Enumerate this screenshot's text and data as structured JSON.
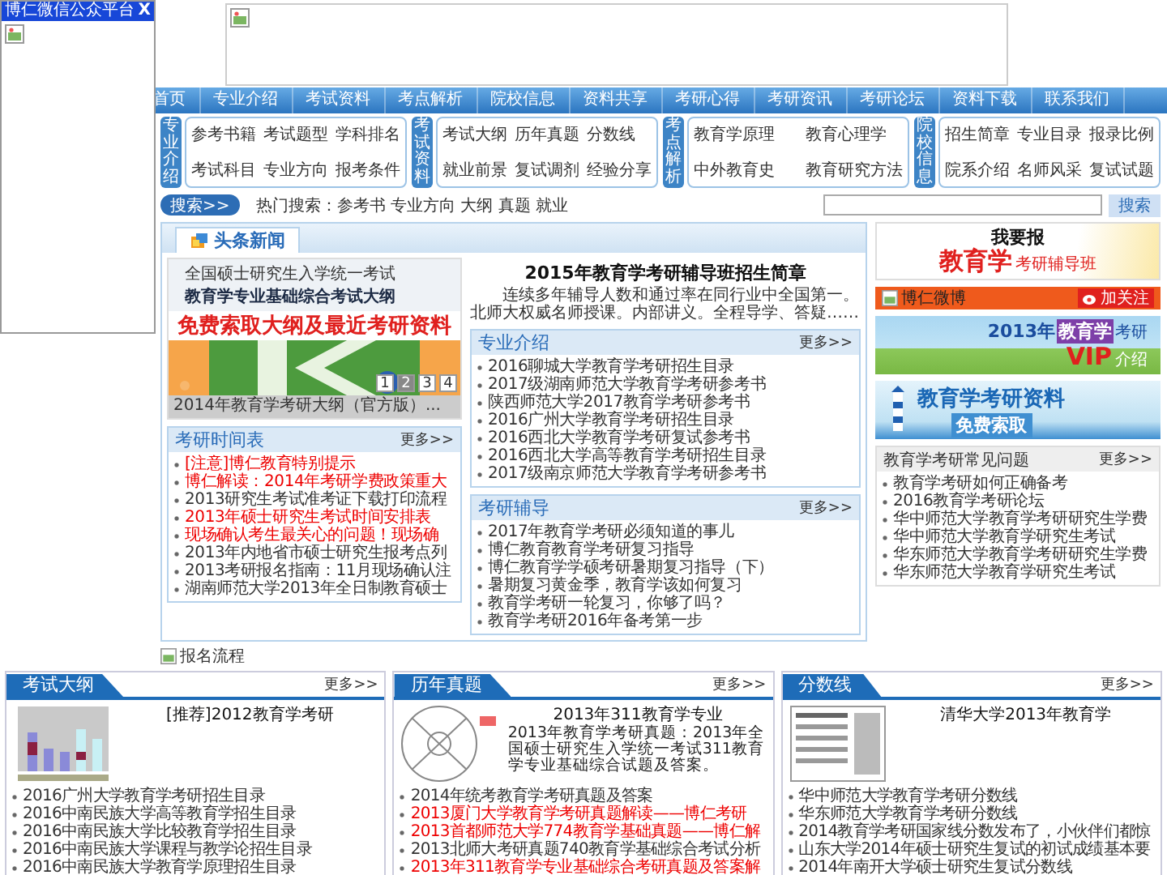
{
  "popup": {
    "title": "博仁微信公众平台",
    "close": "X"
  },
  "nav": [
    "首页",
    "专业介绍",
    "考试资料",
    "考点解析",
    "院校信息",
    "资料共享",
    "考研心得",
    "考研资讯",
    "考研论坛",
    "资料下载",
    "联系我们"
  ],
  "categories": [
    {
      "label": "专业介绍",
      "links": [
        "参考书籍",
        "考试题型",
        "学科排名",
        "考试科目",
        "专业方向",
        "报考条件"
      ]
    },
    {
      "label": "考试资料",
      "links": [
        "考试大纲",
        "历年真题",
        "分数线",
        "就业前景",
        "复试调剂",
        "经验分享"
      ]
    },
    {
      "label": "考点解析",
      "links": [
        "教育学原理",
        "教育心理学",
        "中外教育史",
        "教育研究方法"
      ]
    },
    {
      "label": "院校信息",
      "links": [
        "招生简章",
        "专业目录",
        "报录比例",
        "院系介绍",
        "名师风采",
        "复试试题"
      ]
    }
  ],
  "search": {
    "button": "搜索>>",
    "hot": "热门搜索：参考书 专业方向 大纲 真题 就业",
    "submit": "搜索"
  },
  "headline_panel": {
    "title": "头条新闻",
    "slideshow": {
      "cover_subtitle": "全国硕士研究生入学统一考试",
      "cover_title": "教育学专业基础综合考试大纲",
      "promo": "免费索取大纲及最近考研资料",
      "caption": "2014年教育学考研大纲（官方版）...",
      "pages": [
        {
          "label": "1",
          "selected": false
        },
        {
          "label": "2",
          "selected": true
        },
        {
          "label": "3",
          "selected": false
        },
        {
          "label": "4",
          "selected": false
        }
      ]
    },
    "headline": {
      "title": "2015年教育学考研辅导班招生简章",
      "summary": "连续多年辅导人数和通过率在同行业中全国第一。北师大权威名师授课。内部讲义。全程导学、答疑……"
    }
  },
  "schedule": {
    "title": "考研时间表",
    "more": "更多>>",
    "items": [
      {
        "text": "[注意]博仁教育特别提示",
        "highlighted": true
      },
      {
        "text": "博仁解读：2014年考研学费政策重大",
        "highlighted": true
      },
      {
        "text": "2013研究生考试准考证下载打印流程",
        "highlighted": false
      },
      {
        "text": "2013年硕士研究生考试时间安排表",
        "highlighted": true
      },
      {
        "text": "现场确认考生最关心的问题！现场确",
        "highlighted": true
      },
      {
        "text": "2013年内地省市硕士研究生报考点列",
        "highlighted": false
      },
      {
        "text": "2013考研报名指南：11月现场确认注",
        "highlighted": false
      },
      {
        "text": "湖南师范大学2013年全日制教育硕士",
        "highlighted": false
      }
    ]
  },
  "major_intro": {
    "title": "专业介绍",
    "more": "更多>>",
    "items": [
      "2016聊城大学教育学考研招生目录",
      "2017级湖南师范大学教育学考研参考书",
      "陕西师范大学2017教育学考研参考书",
      "2016广州大学教育学考研招生目录",
      "2016西北大学教育学考研复试参考书",
      "2016西北大学高等教育学考研招生目录",
      "2017级南京师范大学教育学考研参考书"
    ]
  },
  "tutoring": {
    "title": "考研辅导",
    "more": "更多>>",
    "items": [
      "2017年教育学考研必须知道的事儿",
      "博仁教育教育学考研复习指导",
      "博仁教育学学硕考研暑期复习指导（下）",
      "暑期复习黄金季，教育学该如何复习",
      "教育学考研一轮复习，你够了吗？",
      "教育学考研2016年备考第一步"
    ]
  },
  "ad_signup": {
    "line1": "我要报",
    "highlight": "教育学",
    "rest": "考研辅导班"
  },
  "weibo": {
    "alt": "博仁微博",
    "follow": "加关注"
  },
  "ad_vip": {
    "year": "2013年",
    "subject": "教育学",
    "suffix": "考研",
    "vip": "VIP",
    "label": "介绍"
  },
  "ad_materials": {
    "title": "教育学考研资料",
    "tagline": "免费索取"
  },
  "faq": {
    "title": "教育学考研常见问题",
    "more": "更多>>",
    "items": [
      "教育学考研如何正确备考",
      "2016教育学考研论坛",
      "华中师范大学教育学考研研究生学费",
      "华中师范大学教育学研究生考试",
      "华东师范大学教育学考研研究生学费",
      "华东师范大学教育学研究生考试"
    ]
  },
  "signup_image": {
    "alt": "报名流程"
  },
  "bottom_sections": [
    {
      "title": "考试大纲",
      "more": "更多>>",
      "feature_title": "[推荐]2012教育学考研",
      "items": [
        {
          "text": "2016广州大学教育学考研招生目录",
          "highlighted": false
        },
        {
          "text": "2016中南民族大学高等教育学招生目录",
          "highlighted": false
        },
        {
          "text": "2016中南民族大学比较教育学招生目录",
          "highlighted": false
        },
        {
          "text": "2016中南民族大学课程与教学论招生目录",
          "highlighted": false
        },
        {
          "text": "2016中南民族大学教育学原理招生目录",
          "highlighted": false
        }
      ]
    },
    {
      "title": "历年真题",
      "more": "更多>>",
      "feature_title": "2013年311教育学专业",
      "feature_summary": "2013年教育学考研真题：2013年全国硕士研究生入学统一考试311教育学专业基础综合试题及答案。",
      "items": [
        {
          "text": "2014年统考教育学考研真题及答案",
          "highlighted": false
        },
        {
          "text": "2013厦门大学教育学考研真题解读——博仁考研",
          "highlighted": true
        },
        {
          "text": "2013首都师范大学774教育学基础真题——博仁解",
          "highlighted": true
        },
        {
          "text": "2013北师大考研真题740教育学基础综合考试分析",
          "highlighted": false
        },
        {
          "text": "2013年311教育学专业基础综合考研真题及答案解",
          "highlighted": true
        }
      ]
    },
    {
      "title": "分数线",
      "more": "更多>>",
      "feature_title": "清华大学2013年教育学",
      "items": [
        {
          "text": "华中师范大学教育学考研分数线",
          "highlighted": false
        },
        {
          "text": "华东师范大学教育学考研分数线",
          "highlighted": false
        },
        {
          "text": "2014教育学考研国家线分数发布了，小伙伴们都惊",
          "highlighted": false
        },
        {
          "text": "山东大学2014年硕士研究生复试的初试成绩基本要",
          "highlighted": false
        },
        {
          "text": "2014年南开大学硕士研究生复试分数线",
          "highlighted": false
        }
      ]
    }
  ]
}
